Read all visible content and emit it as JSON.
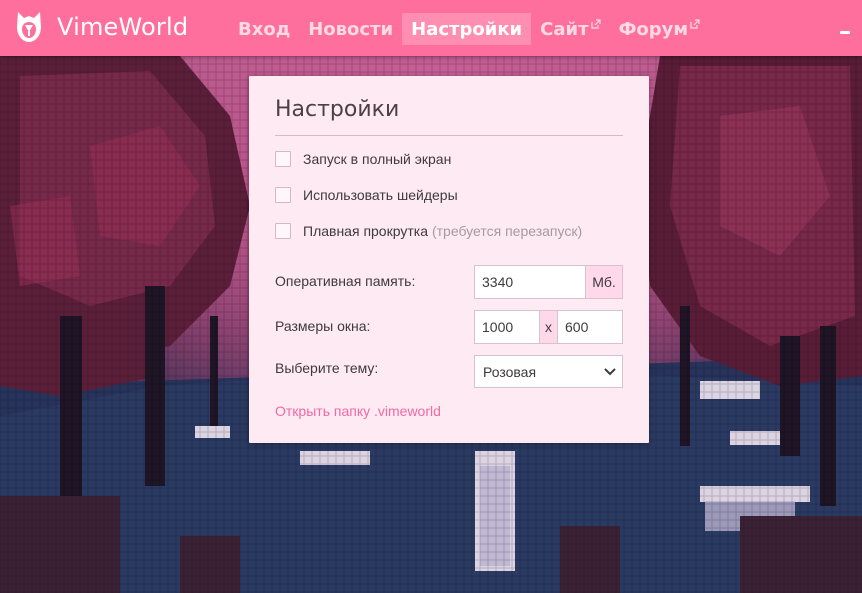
{
  "app": {
    "brand": "VimeWorld",
    "logo_icon": "owl-logo-icon",
    "minimize_icon": "minimize-icon"
  },
  "nav": {
    "items": [
      {
        "label": "Вход",
        "active": false,
        "external": false
      },
      {
        "label": "Новости",
        "active": false,
        "external": false
      },
      {
        "label": "Настройки",
        "active": true,
        "external": false
      },
      {
        "label": "Сайт",
        "active": false,
        "external": true
      },
      {
        "label": "Форум",
        "active": false,
        "external": true
      }
    ]
  },
  "settings": {
    "title": "Настройки",
    "checkboxes": [
      {
        "label": "Запуск в полный экран",
        "hint": "",
        "checked": false
      },
      {
        "label": "Использовать шейдеры",
        "hint": "",
        "checked": false
      },
      {
        "label": "Плавная прокрутка",
        "hint": "(требуется перезапуск)",
        "checked": false
      }
    ],
    "memory": {
      "label": "Оперативная память:",
      "value": "3340",
      "unit": "Мб."
    },
    "window_size": {
      "label": "Размеры окна:",
      "width": "1000",
      "separator": "x",
      "height": "600"
    },
    "theme": {
      "label": "Выберите тему:",
      "selected": "Розовая"
    },
    "open_folder": "Открыть папку .vimeworld"
  },
  "colors": {
    "header": "#ff6f9d",
    "nav_active": "#ff8eb2",
    "panel": "#fdeaf3",
    "link": "#f16aa3",
    "addon": "#ffd8ea"
  }
}
